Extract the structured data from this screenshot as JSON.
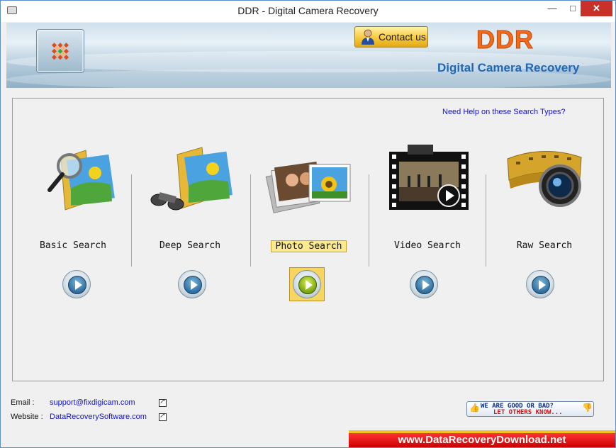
{
  "window": {
    "title": "DDR - Digital Camera Recovery",
    "controls": {
      "minimize": "—",
      "maximize": "□",
      "close": "✕"
    }
  },
  "header": {
    "contact_label": "Contact us",
    "logo_text": "DDR",
    "product_name": "Digital Camera Recovery"
  },
  "main": {
    "help_link": "Need Help on these Search Types?",
    "search_types": [
      {
        "label": "Basic Search",
        "selected": false
      },
      {
        "label": "Deep Search",
        "selected": false
      },
      {
        "label": "Photo Search",
        "selected": true
      },
      {
        "label": "Video Search",
        "selected": false
      },
      {
        "label": "Raw Search",
        "selected": false
      }
    ]
  },
  "footer": {
    "email_label": "Email :",
    "email_value": "support@fixdigicam.com",
    "website_label": "Website :",
    "website_value": "DataRecoverySoftware.com",
    "feedback_line1": "WE ARE GOOD OR BAD?",
    "feedback_line2": "LET OTHERS KNOW..."
  },
  "watermark": "www.DataRecoveryDownload.net",
  "colors": {
    "accent_blue": "#2067b5",
    "ddr_orange": "#f46a1a",
    "close_red": "#c7312a",
    "selected_bg": "#fbe98f",
    "link_blue": "#1212c8"
  }
}
